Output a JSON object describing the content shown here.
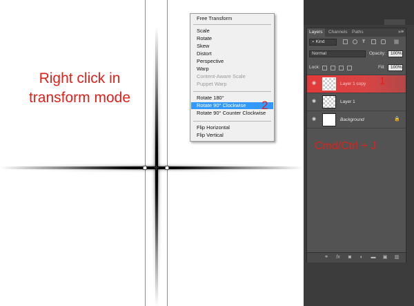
{
  "annotation": {
    "instruction": "Right click in transform mode",
    "step1": "1",
    "step2": "2",
    "shortcut": "Cmd/Ctrl + J"
  },
  "context_menu": {
    "items": [
      {
        "label": "Free Transform",
        "state": "normal"
      },
      {
        "label": "Scale",
        "state": "normal"
      },
      {
        "label": "Rotate",
        "state": "normal"
      },
      {
        "label": "Skew",
        "state": "normal"
      },
      {
        "label": "Distort",
        "state": "normal"
      },
      {
        "label": "Perspective",
        "state": "normal"
      },
      {
        "label": "Warp",
        "state": "normal"
      },
      {
        "label": "Content-Aware Scale",
        "state": "disabled"
      },
      {
        "label": "Puppet Warp",
        "state": "disabled"
      },
      {
        "label": "Rotate 180°",
        "state": "normal"
      },
      {
        "label": "Rotate 90° Clockwise",
        "state": "active"
      },
      {
        "label": "Rotate 90° Counter Clockwise",
        "state": "normal"
      },
      {
        "label": "Flip Horizontal",
        "state": "normal"
      },
      {
        "label": "Flip Vertical",
        "state": "normal"
      }
    ]
  },
  "layers_panel": {
    "tabs": [
      "Layers",
      "Channels",
      "Paths"
    ],
    "menu_icon": "»≡",
    "filter_kind": "Kind",
    "blend_mode": "Normal",
    "opacity_label": "Opacity:",
    "opacity_value": "100%",
    "lock_label": "Lock:",
    "fill_label": "Fill:",
    "fill_value": "100%",
    "layers": [
      {
        "name": "Layer 1 copy",
        "selected": true,
        "thumb": "transparent"
      },
      {
        "name": "Layer 1",
        "selected": false,
        "thumb": "transparent"
      },
      {
        "name": "Background",
        "selected": false,
        "thumb": "white",
        "locked": true
      }
    ]
  },
  "icons": {
    "eye": "eye-icon",
    "lock": "lock-icon",
    "link": "link-icon",
    "fx": "fx-icon",
    "mask": "mask-icon",
    "adjustment": "adjustment-icon",
    "group": "folder-icon",
    "new_layer": "new-layer-icon",
    "delete": "trash-icon"
  },
  "colors": {
    "annotation_red": "#e0201b",
    "menu_highlight": "#3399ff",
    "panel_bg": "#535353",
    "selected_layer": "#e23a3a"
  }
}
